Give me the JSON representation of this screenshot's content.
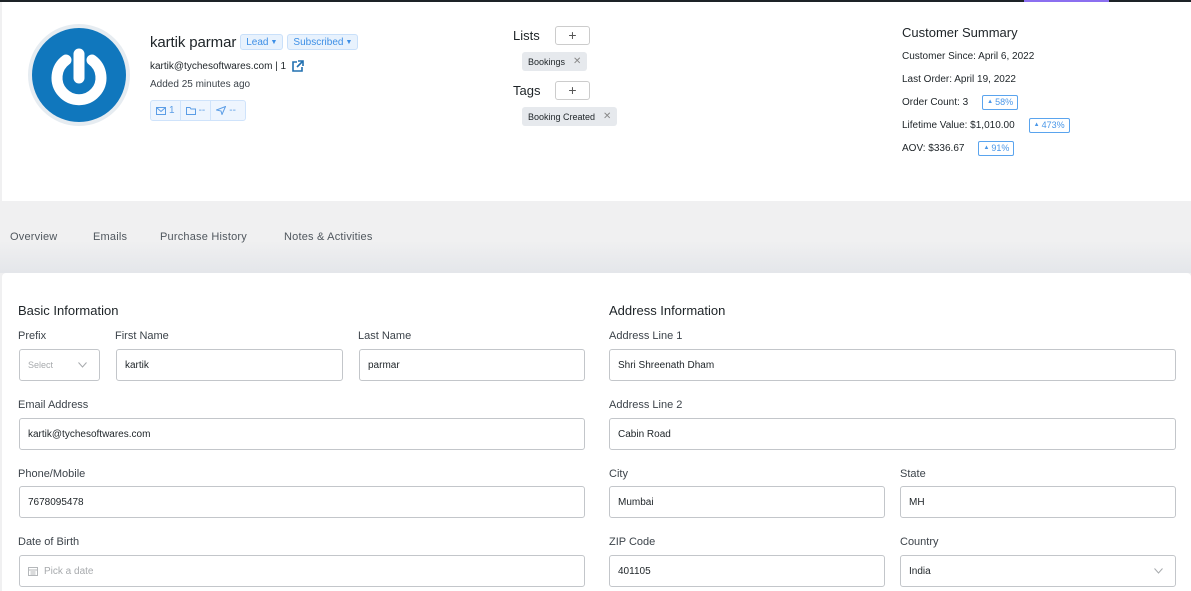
{
  "contact": {
    "name": "kartik parmar",
    "status_label": "Lead",
    "subscription_label": "Subscribed",
    "email_line": "kartik@tychesoftwares.com | 1",
    "added": "Added 25 minutes ago",
    "stats": {
      "emails": "1",
      "folders": "--",
      "sent": "--"
    }
  },
  "lists": {
    "label": "Lists",
    "add_label": "+",
    "items": [
      "Bookings"
    ]
  },
  "tags": {
    "label": "Tags",
    "add_label": "+",
    "items": [
      "Booking Created"
    ]
  },
  "summary": {
    "title": "Customer Summary",
    "customer_since": "Customer Since: April 6, 2022",
    "last_order": "Last Order: April 19, 2022",
    "order_count": "Order Count: 3",
    "order_count_trend": "58%",
    "lifetime_value": "Lifetime Value: $1,010.00",
    "lifetime_value_trend": "473%",
    "aov": "AOV: $336.67",
    "aov_trend": "91%"
  },
  "tabs": [
    {
      "label": "Overview"
    },
    {
      "label": "Emails"
    },
    {
      "label": "Purchase History"
    },
    {
      "label": "Notes & Activities"
    }
  ],
  "basic": {
    "title": "Basic Information",
    "prefix_label": "Prefix",
    "prefix_placeholder": "Select",
    "first_name_label": "First Name",
    "first_name": "kartik",
    "last_name_label": "Last Name",
    "last_name": "parmar",
    "email_label": "Email Address",
    "email": "kartik@tychesoftwares.com",
    "phone_label": "Phone/Mobile",
    "phone": "7678095478",
    "dob_label": "Date of Birth",
    "dob_placeholder": "Pick a date"
  },
  "address": {
    "title": "Address Information",
    "line1_label": "Address Line 1",
    "line1": "Shri Shreenath Dham",
    "line2_label": "Address Line 2",
    "line2": "Cabin Road",
    "city_label": "City",
    "city": "Mumbai",
    "state_label": "State",
    "state": "MH",
    "zip_label": "ZIP Code",
    "zip": "401105",
    "country_label": "Country",
    "country": "India"
  },
  "colors": {
    "accent_blue": "#1077bd",
    "link_blue": "#3d8fe6",
    "top_accent": "#8b6ff0"
  }
}
